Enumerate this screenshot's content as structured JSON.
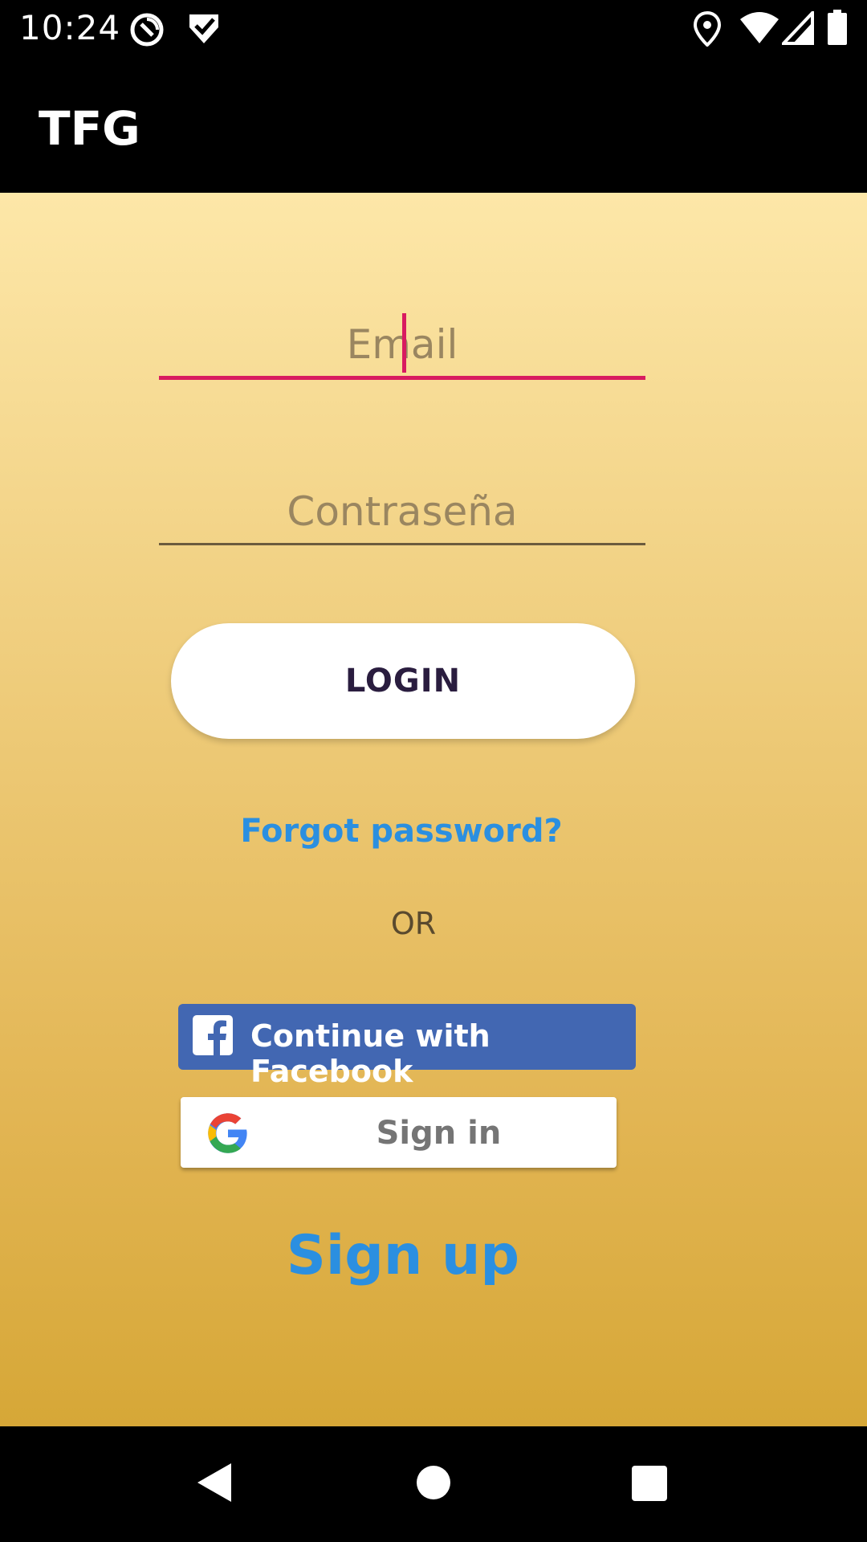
{
  "status_bar": {
    "time": "10:24",
    "left_icons": [
      "no-disturb-icon",
      "check-shield-icon"
    ],
    "right_icons": [
      "location-icon",
      "wifi-icon",
      "signal-icon",
      "battery-icon"
    ]
  },
  "app_bar": {
    "title": "TFG"
  },
  "login_form": {
    "email_placeholder": "Email",
    "password_placeholder": "Contraseña",
    "login_label": "LOGIN",
    "forgot_label": "Forgot password?",
    "or_label": "OR"
  },
  "social": {
    "facebook_label": "Continue with Facebook",
    "google_label": "Sign in"
  },
  "signup_label": "Sign up",
  "nav_bar": {
    "buttons": [
      "back-icon",
      "home-icon",
      "recents-icon"
    ]
  },
  "colors": {
    "accent": "#d81b60",
    "link": "#2b8fe0",
    "facebook": "#4267b2",
    "gradient_top": "#fde7a8",
    "gradient_bottom": "#d6a737"
  }
}
